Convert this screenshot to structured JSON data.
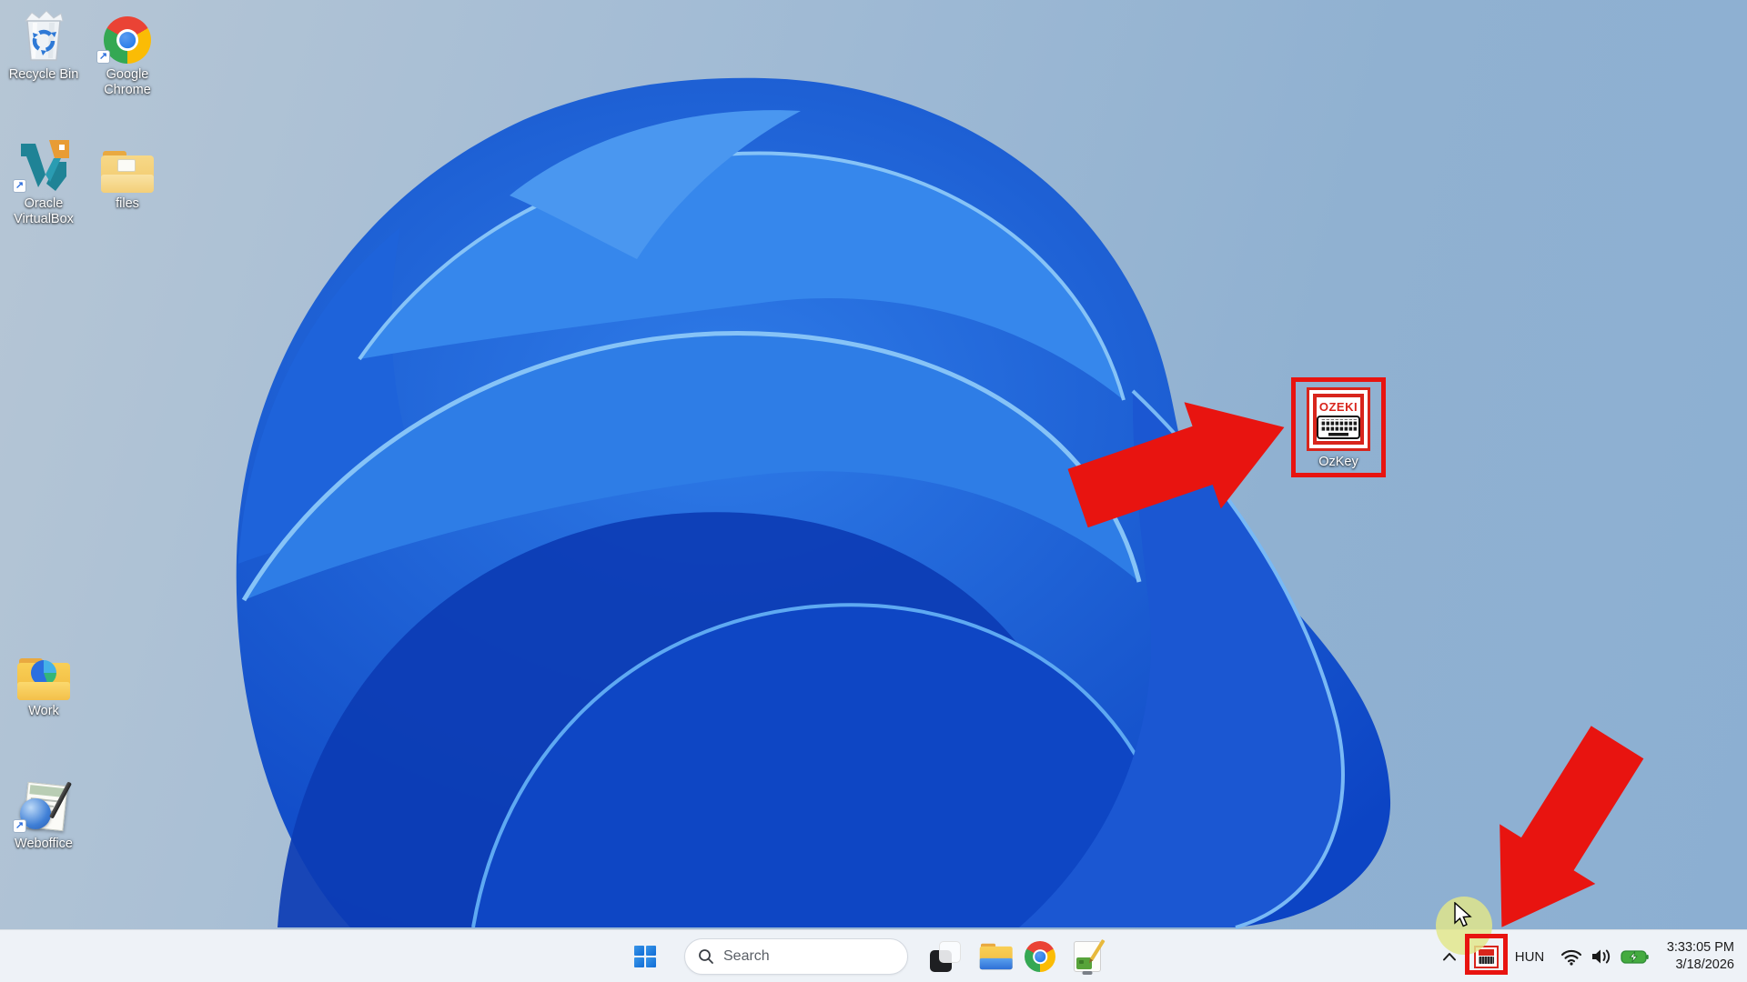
{
  "desktop": {
    "icons": [
      {
        "id": "recycle-bin",
        "label": "Recycle Bin"
      },
      {
        "id": "google-chrome",
        "label": "Google Chrome"
      },
      {
        "id": "oracle-virtualbox",
        "label": "Oracle VirtualBox"
      },
      {
        "id": "files",
        "label": "files"
      },
      {
        "id": "work",
        "label": "Work"
      },
      {
        "id": "weboffice",
        "label": "Weboffice"
      },
      {
        "id": "ozkey",
        "label": "OzKey"
      }
    ],
    "ozkey_icon_text": "OZEKI"
  },
  "taskbar": {
    "search_placeholder": "Search",
    "app_icons": [
      "start-icon",
      "search-icon",
      "window-stack-icon",
      "file-explorer-icon",
      "chrome-icon",
      "editor-icon"
    ],
    "tray_icons": [
      "chevron-up-icon",
      "ozkey-tray-icon",
      "wifi-icon",
      "volume-icon",
      "battery-charging-icon"
    ]
  },
  "tray": {
    "language": "HUN",
    "time": "3:33:05 PM",
    "date": "3/18/2026"
  },
  "colors": {
    "annotation_red": "#e81410",
    "taskbar_bg": "#eef2f7",
    "battery_green": "#44ab40",
    "bloom_deep_blue": "#0c3cb4",
    "bloom_light_blue": "#4a97f0"
  }
}
